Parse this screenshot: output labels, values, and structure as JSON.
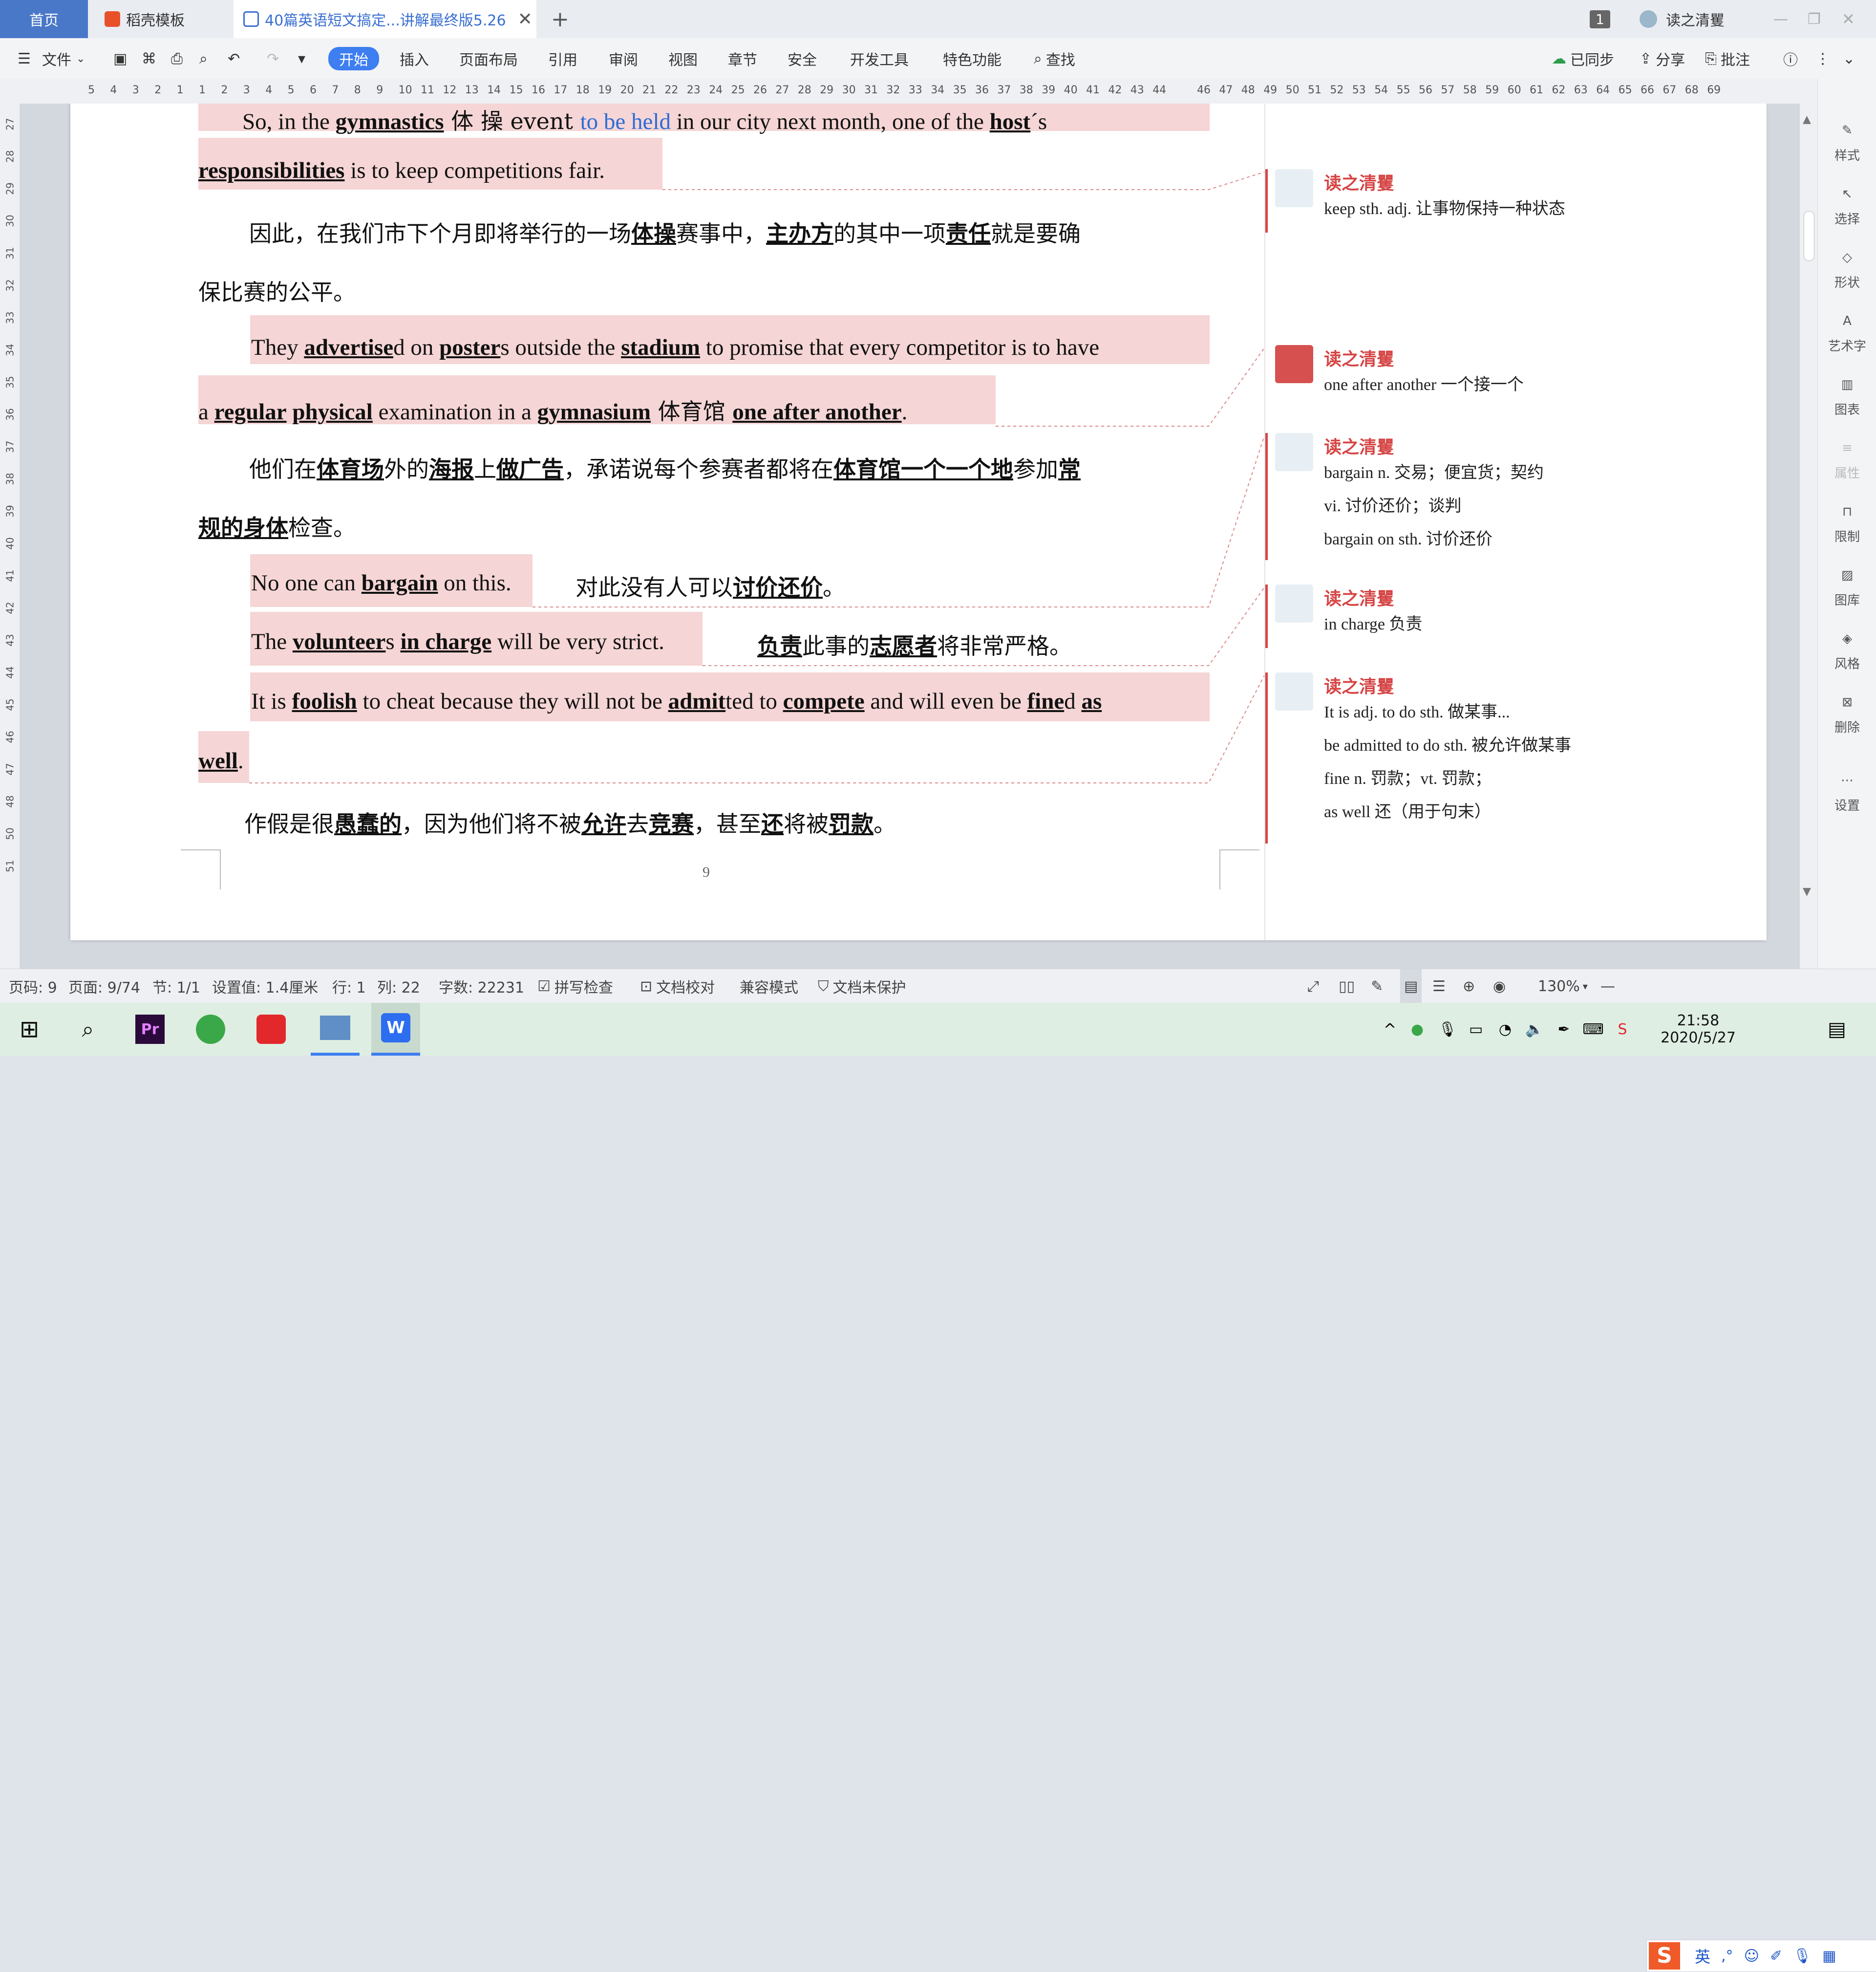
{
  "tabs": {
    "home": "首页",
    "template": "稻壳模板",
    "document": "40篇英语短文搞定...讲解最终版5.26",
    "badge": "1",
    "user": "读之清矍"
  },
  "toolbar": {
    "file": "文件",
    "items": [
      "开始",
      "插入",
      "页面布局",
      "引用",
      "审阅",
      "视图",
      "章节",
      "安全",
      "开发工具",
      "特色功能"
    ],
    "search": "查找",
    "sync": "已同步",
    "share": "分享",
    "annotate": "批注"
  },
  "ruler": {
    "ticks": [
      "5",
      "4",
      "3",
      "2",
      "1",
      "1",
      "2",
      "3",
      "4",
      "5",
      "6",
      "7",
      "8",
      "9",
      "10",
      "11",
      "12",
      "13",
      "14",
      "15",
      "16",
      "17",
      "18",
      "19",
      "20",
      "21",
      "22",
      "23",
      "24",
      "25",
      "26",
      "27",
      "28",
      "29",
      "30",
      "31",
      "32",
      "33",
      "34",
      "35",
      "36",
      "37",
      "38",
      "39",
      "40",
      "41",
      "42",
      "43",
      "44",
      "46",
      "47",
      "48",
      "49",
      "50",
      "51",
      "52",
      "53",
      "54",
      "55",
      "56",
      "57",
      "58",
      "59",
      "60",
      "61",
      "62",
      "63",
      "64",
      "65",
      "66",
      "67",
      "68",
      "69"
    ],
    "vticks": [
      "27",
      "28",
      "29",
      "30",
      "31",
      "32",
      "33",
      "34",
      "35",
      "36",
      "37",
      "38",
      "39",
      "40",
      "41",
      "42",
      "43",
      "44",
      "45",
      "46",
      "47",
      "48",
      "50",
      "51"
    ]
  },
  "document": {
    "l1_a": "So, in the ",
    "l1_w1": "gymnastics",
    "l1_b": " 体 操 event ",
    "l1_blue": "to be held",
    "l1_c": " in our city next month, one of the ",
    "l1_w2": "host",
    "l1_d": "´s",
    "l2_w": "responsibilities",
    "l2_a": " is to keep competitions fair.",
    "c1_a": "因此，在我们市下个月即将举行的一场",
    "c1_w1": "体操",
    "c1_b": "赛事中，",
    "c1_w2": "主办方",
    "c1_c": "的其中一项",
    "c1_w3": "责任",
    "c1_d": "就是要确",
    "c1_e": "保比赛的公平。",
    "l3_a": "They ",
    "l3_w1": "advertise",
    "l3_b": "d on ",
    "l3_w2": "poster",
    "l3_c": "s outside the ",
    "l3_w3": "stadium",
    "l3_d": " to promise that every competitor is to have",
    "l4_a": "a ",
    "l4_w1": "regular",
    "l4_w2": "physical",
    "l4_b": " examination in a ",
    "l4_w3": "gymnasium",
    "l4_c": "  体育馆  ",
    "l4_w4": "one after another",
    "l4_d": ".",
    "c2_a": "他们在",
    "c2_w1": "体育场",
    "c2_b": "外的",
    "c2_w2": "海报",
    "c2_c": "上",
    "c2_w3": "做广告",
    "c2_d": "，承诺说每个参赛者都将在",
    "c2_w4": "体育馆一个一个地",
    "c2_e": "参加",
    "c2_w5": "常",
    "c2_w6": "规的身体",
    "c2_f": "检查。",
    "l5_a": "No one can ",
    "l5_w": "bargain",
    "l5_b": " on this.",
    "l5_cn_a": "对此没有人可以",
    "l5_cn_w": "讨价还价",
    "l5_cn_b": "。",
    "l6_a": "The ",
    "l6_w1": "volunteer",
    "l6_b": "s ",
    "l6_w2": "in charge",
    "l6_c": " will be very strict.",
    "l6_cn_w1": "负责",
    "l6_cn_a": "此事的",
    "l6_cn_w2": "志愿者",
    "l6_cn_b": "将非常严格。",
    "l7_a": "It is ",
    "l7_w1": "foolish",
    "l7_b": " to cheat because they will not be ",
    "l7_w2": "admit",
    "l7_c": "ted to ",
    "l7_w3": "compete",
    "l7_d": " and will even be ",
    "l7_w4": "fine",
    "l7_e": "d ",
    "l7_w5": "as",
    "l8_w": "well",
    "l8_a": ".",
    "c3_a": "作假是很",
    "c3_w1": "愚蠢的",
    "c3_b": "，因为他们将不被",
    "c3_w2": "允许",
    "c3_c": "去",
    "c3_w3": "竞赛",
    "c3_d": "，甚至",
    "c3_w4": "还",
    "c3_e": "将被",
    "c3_w5": "罚款",
    "c3_f": "。",
    "page_number": "9"
  },
  "comments": [
    {
      "author": "读之清矍",
      "lines": [
        "keep sth. adj.  让事物保持一种状态"
      ]
    },
    {
      "author": "读之清矍",
      "lines": [
        "one after another  一个接一个"
      ]
    },
    {
      "author": "读之清矍",
      "lines": [
        "bargain    n.  交易；便宜货；契约",
        "vi.  讨价还价；谈判",
        "bargain on sth.  讨价还价"
      ]
    },
    {
      "author": "读之清矍",
      "lines": [
        "in charge  负责"
      ]
    },
    {
      "author": "读之清矍",
      "lines": [
        "It is adj. to do sth.  做某事...",
        "be admitted to do sth.  被允许做某事",
        "fine    n.  罚款；vt.  罚款；",
        "as well  还（用于句末）"
      ]
    }
  ],
  "right_panel": [
    "样式",
    "选择",
    "形状",
    "艺术字",
    "图表",
    "属性",
    "限制",
    "图库",
    "风格",
    "删除",
    "设置"
  ],
  "status": {
    "page_code": "页码: 9",
    "page": "页面: 9/74",
    "section": "节: 1/1",
    "setting": "设置值: 1.4厘米",
    "row": "行: 1",
    "col": "列: 22",
    "words": "字数: 22231",
    "spell": "拼写检查",
    "proof": "文档校对",
    "compat": "兼容模式",
    "protect": "文档未保护",
    "zoom": "130%",
    "ime": "英"
  },
  "taskbar": {
    "time": "21:58",
    "date": "2020/5/27"
  },
  "colors": {
    "accent": "#3d7ef0",
    "highlight": "#f5d5d5",
    "comment_author": "#d64545",
    "link_blue": "#2b6cd8"
  }
}
